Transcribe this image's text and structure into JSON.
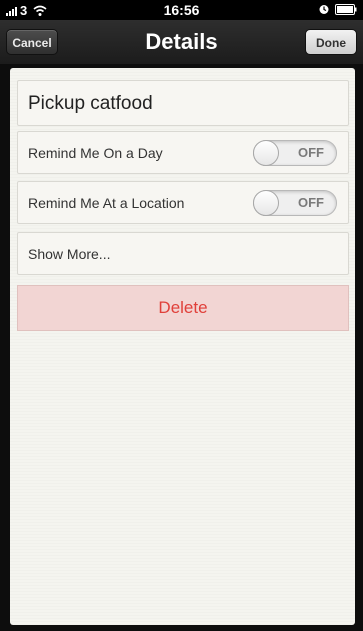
{
  "status_bar": {
    "carrier": "3",
    "time": "16:56",
    "icons": [
      "signal-icon",
      "wifi-icon",
      "lock-icon",
      "battery-icon"
    ]
  },
  "navbar": {
    "cancel_label": "Cancel",
    "title": "Details",
    "done_label": "Done"
  },
  "reminder": {
    "title": "Pickup catfood",
    "remind_day_label": "Remind Me On a Day",
    "remind_day_toggle": "OFF",
    "remind_location_label": "Remind Me At a Location",
    "remind_location_toggle": "OFF",
    "show_more_label": "Show More...",
    "delete_label": "Delete"
  },
  "colors": {
    "delete_text": "#e0403a",
    "delete_bg": "#f2d5d3",
    "navbar_bg": "#2a2a2a"
  }
}
